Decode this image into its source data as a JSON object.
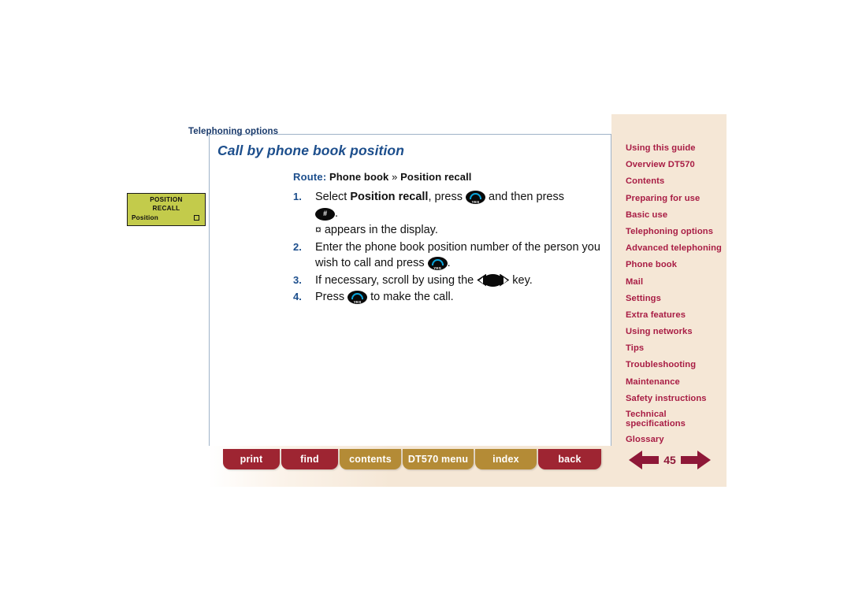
{
  "document": {
    "breadcrumb": "Telephoning options",
    "title": "Call by phone book position",
    "page_number": "45"
  },
  "route": {
    "label": "Route:",
    "step1": "Phone book",
    "separator": "»",
    "step2": "Position recall"
  },
  "display_graphic": {
    "line1": "POSITION",
    "line2": "RECALL",
    "line3": "Position",
    "marker_icon": "square-marker-icon"
  },
  "steps": [
    {
      "number": "1.",
      "prefix": "Select ",
      "bold": "Position recall",
      "middle": ", press ",
      "key1": "yes-key-icon",
      "after_key1": " and then press ",
      "key2": "hash-key-icon",
      "suffix": ".",
      "note_symbol": "¤",
      "note": " appears in the display."
    },
    {
      "number": "2.",
      "prefix": "Enter the phone book position number of the person you wish to call and press ",
      "key1": "yes-key-icon",
      "suffix": "."
    },
    {
      "number": "3.",
      "prefix": "If necessary, scroll by using the ",
      "key1": "scroll-key-icon",
      "suffix": " key."
    },
    {
      "number": "4.",
      "prefix": "Press ",
      "key1": "yes-key-icon",
      "suffix": " to make the call."
    }
  ],
  "sidebar": {
    "items": [
      {
        "label": "Using this guide"
      },
      {
        "label": "Overview DT570"
      },
      {
        "label": "Contents"
      },
      {
        "label": "Preparing for use"
      },
      {
        "label": "Basic use"
      },
      {
        "label": "Telephoning options"
      },
      {
        "label": "Advanced telephoning"
      },
      {
        "label": "Phone book"
      },
      {
        "label": "Mail"
      },
      {
        "label": "Settings"
      },
      {
        "label": "Extra features"
      },
      {
        "label": "Using networks"
      },
      {
        "label": "Tips"
      },
      {
        "label": "Troubleshooting"
      },
      {
        "label": "Maintenance"
      },
      {
        "label": "Safety instructions"
      },
      {
        "label": "Technical\nspecifications"
      },
      {
        "label": "Glossary"
      }
    ]
  },
  "toolbar": {
    "buttons": [
      {
        "label": "print",
        "style": "red"
      },
      {
        "label": "find",
        "style": "red"
      },
      {
        "label": "contents",
        "style": "gold"
      },
      {
        "label": "DT570 menu",
        "style": "gold"
      },
      {
        "label": "index",
        "style": "gold"
      },
      {
        "label": "back",
        "style": "red"
      }
    ]
  },
  "colors": {
    "sidebar_bg": "#f5e7d6",
    "sidebar_link": "#a81c44",
    "title_blue": "#1c4e8c",
    "breadcrumb_blue": "#1a3a6b",
    "toolbar_red": "#9e2532",
    "toolbar_gold": "#b48b36",
    "arrow_maroon": "#8e1838",
    "display_olive": "#c3cb4b"
  }
}
